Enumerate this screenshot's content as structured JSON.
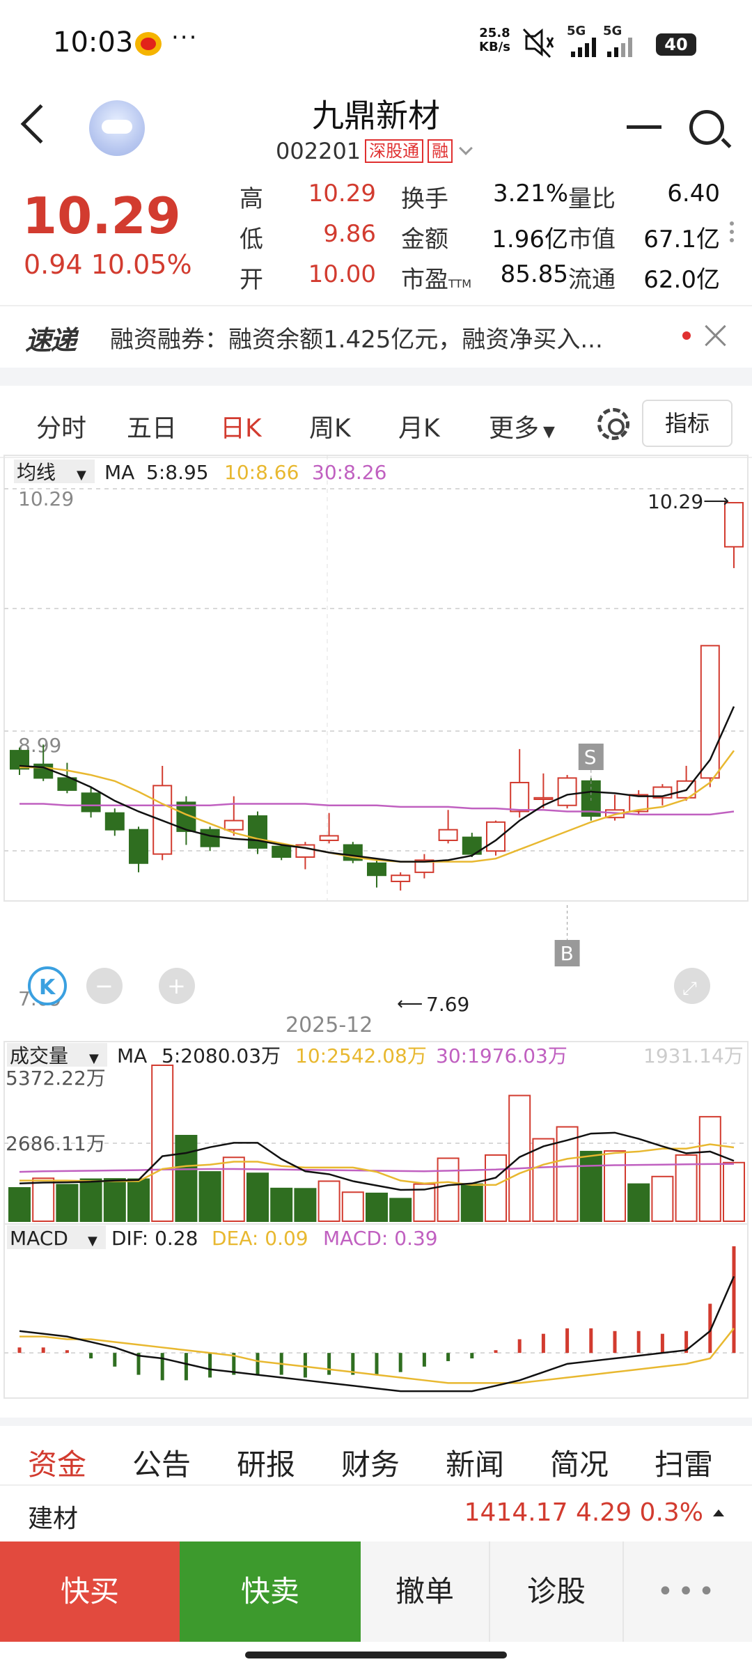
{
  "status_bar": {
    "time": "10:03",
    "dots": "···",
    "net_rate_value": "25.8",
    "net_rate_unit": "KB/s",
    "battery": "40",
    "signal1": "5G",
    "signal2": "5G"
  },
  "header": {
    "title": "九鼎新材",
    "code": "002201",
    "tag1": "深股通",
    "tag2": "融"
  },
  "quote": {
    "price": "10.29",
    "change": "0.94  10.05%",
    "rows": [
      [
        {
          "label": "高",
          "value": "10.29"
        },
        {
          "label": "换手",
          "value": "3.21%"
        },
        {
          "label": "量比",
          "value": "6.40"
        }
      ],
      [
        {
          "label": "低",
          "value": "9.86"
        },
        {
          "label": "金额",
          "value": "1.96亿"
        },
        {
          "label": "市值",
          "value": "67.1亿"
        }
      ],
      [
        {
          "label": "开",
          "value": "10.00"
        },
        {
          "label": "市盈",
          "label_sub": "TTM",
          "value": "85.85"
        },
        {
          "label": "流通",
          "value": "62.0亿"
        }
      ]
    ]
  },
  "ticker": {
    "logo": "速递",
    "text": "融资融券：融资余额1.425亿元，融资净买入..."
  },
  "chart_tabs": {
    "items": [
      "分时",
      "五日",
      "日K",
      "周K",
      "月K",
      "更多"
    ],
    "active": "日K",
    "indicator_button": "指标"
  },
  "colors": {
    "up": "#d23b2f",
    "down": "#2f6e20",
    "ma5": "#111111",
    "ma10": "#e8b830",
    "ma30": "#c060c0",
    "buy": "#e24a3e",
    "sell": "#3d9a2d"
  },
  "chart_data": [
    {
      "type": "candlestick",
      "legend": {
        "label": "均线",
        "ma_label": "MA",
        "ma5": "5:8.95",
        "ma10": "10:8.66",
        "ma30": "30:8.26"
      },
      "y_labels": [
        "10.29",
        "8.99",
        "7.69"
      ],
      "ylim": [
        7.69,
        10.29
      ],
      "x_label": "2025-12",
      "high_marker": "10.29",
      "low_marker": "7.69",
      "signals": [
        {
          "label": "S",
          "index": 24
        },
        {
          "label": "B",
          "index": 23
        }
      ],
      "candles": [
        {
          "o": 8.66,
          "c": 8.54,
          "h": 8.68,
          "l": 8.5
        },
        {
          "o": 8.57,
          "c": 8.48,
          "h": 8.7,
          "l": 8.46
        },
        {
          "o": 8.48,
          "c": 8.4,
          "h": 8.58,
          "l": 8.38
        },
        {
          "o": 8.38,
          "c": 8.26,
          "h": 8.42,
          "l": 8.22
        },
        {
          "o": 8.25,
          "c": 8.14,
          "h": 8.28,
          "l": 8.1
        },
        {
          "o": 8.14,
          "c": 7.92,
          "h": 8.16,
          "l": 7.86
        },
        {
          "o": 7.98,
          "c": 8.43,
          "h": 8.56,
          "l": 7.94
        },
        {
          "o": 8.32,
          "c": 8.13,
          "h": 8.36,
          "l": 8.04
        },
        {
          "o": 8.14,
          "c": 8.03,
          "h": 8.16,
          "l": 8.0
        },
        {
          "o": 8.14,
          "c": 8.2,
          "h": 8.36,
          "l": 8.1
        },
        {
          "o": 8.23,
          "c": 8.02,
          "h": 8.26,
          "l": 7.98
        },
        {
          "o": 8.03,
          "c": 7.96,
          "h": 8.04,
          "l": 7.94
        },
        {
          "o": 7.96,
          "c": 8.04,
          "h": 8.06,
          "l": 7.88
        },
        {
          "o": 8.07,
          "c": 8.1,
          "h": 8.25,
          "l": 8.05
        },
        {
          "o": 8.04,
          "c": 7.94,
          "h": 8.06,
          "l": 7.92
        },
        {
          "o": 7.92,
          "c": 7.84,
          "h": 7.94,
          "l": 7.76
        },
        {
          "o": 7.8,
          "c": 7.84,
          "h": 7.86,
          "l": 7.74
        },
        {
          "o": 7.86,
          "c": 7.94,
          "h": 7.98,
          "l": 7.82
        },
        {
          "o": 8.07,
          "c": 8.14,
          "h": 8.27,
          "l": 8.05
        },
        {
          "o": 8.09,
          "c": 7.98,
          "h": 8.12,
          "l": 7.96
        },
        {
          "o": 8.0,
          "c": 8.19,
          "h": 8.2,
          "l": 7.97
        },
        {
          "o": 8.26,
          "c": 8.45,
          "h": 8.67,
          "l": 8.22
        },
        {
          "o": 8.34,
          "c": 8.35,
          "h": 8.51,
          "l": 8.28
        },
        {
          "o": 8.3,
          "c": 8.48,
          "h": 8.5,
          "l": 8.28
        },
        {
          "o": 8.46,
          "c": 8.23,
          "h": 8.48,
          "l": 8.2
        },
        {
          "o": 8.22,
          "c": 8.27,
          "h": 8.37,
          "l": 8.2
        },
        {
          "o": 8.26,
          "c": 8.37,
          "h": 8.4,
          "l": 8.24
        },
        {
          "o": 8.35,
          "c": 8.42,
          "h": 8.44,
          "l": 8.3
        },
        {
          "o": 8.35,
          "c": 8.46,
          "h": 8.56,
          "l": 8.33
        },
        {
          "o": 8.48,
          "c": 9.35,
          "h": 9.35,
          "l": 8.42
        },
        {
          "o": 10.0,
          "c": 10.29,
          "h": 10.29,
          "l": 9.86
        }
      ],
      "ma5": [
        8.56,
        8.55,
        8.49,
        8.42,
        8.33,
        8.26,
        8.2,
        8.14,
        8.1,
        8.08,
        8.07,
        8.04,
        8.02,
        7.99,
        7.97,
        7.95,
        7.93,
        7.93,
        7.94,
        7.97,
        8.07,
        8.2,
        8.3,
        8.37,
        8.39,
        8.38,
        8.36,
        8.36,
        8.4,
        8.6,
        8.95
      ],
      "ma10": [
        8.55,
        8.55,
        8.53,
        8.5,
        8.46,
        8.39,
        8.31,
        8.24,
        8.18,
        8.12,
        8.08,
        8.05,
        8.02,
        7.99,
        7.96,
        7.94,
        7.93,
        7.93,
        7.93,
        7.93,
        7.95,
        8.01,
        8.07,
        8.13,
        8.19,
        8.24,
        8.27,
        8.29,
        8.34,
        8.45,
        8.66
      ],
      "ma30": [
        8.31,
        8.31,
        8.3,
        8.3,
        8.3,
        8.3,
        8.3,
        8.3,
        8.3,
        8.31,
        8.31,
        8.31,
        8.31,
        8.3,
        8.3,
        8.3,
        8.29,
        8.29,
        8.29,
        8.28,
        8.28,
        8.27,
        8.27,
        8.26,
        8.26,
        8.25,
        8.24,
        8.24,
        8.24,
        8.24,
        8.26
      ]
    },
    {
      "type": "bar",
      "legend": {
        "label": "成交量",
        "ma_label": "MA",
        "ma5": "5:2080.03万",
        "ma10": "10:2542.08万",
        "ma30": "30:1976.03万"
      },
      "right_label": "1931.14万",
      "y_labels": [
        "5372.22万",
        "2686.11万"
      ],
      "ylim": [
        0,
        5372.22
      ],
      "values": [
        1150,
        1480,
        1260,
        1450,
        1460,
        1450,
        5372,
        2950,
        1700,
        2200,
        1650,
        1130,
        1120,
        1380,
        1000,
        960,
        780,
        1280,
        2170,
        1280,
        2280,
        4330,
        2840,
        3250,
        2400,
        2420,
        1280,
        1540,
        2280,
        3600,
        2020
      ],
      "up": [
        false,
        true,
        false,
        false,
        false,
        false,
        true,
        false,
        false,
        true,
        false,
        false,
        false,
        true,
        true,
        false,
        false,
        true,
        true,
        false,
        true,
        true,
        true,
        true,
        false,
        true,
        false,
        true,
        true,
        true,
        true
      ],
      "ma5": [
        1300,
        1330,
        1340,
        1360,
        1400,
        1420,
        2240,
        2350,
        2550,
        2700,
        2700,
        2140,
        1720,
        1620,
        1380,
        1230,
        1080,
        1090,
        1240,
        1300,
        1500,
        2210,
        2580,
        2790,
        3020,
        3050,
        2840,
        2580,
        2340,
        2400,
        2080
      ],
      "ma10": [
        1400,
        1400,
        1400,
        1380,
        1380,
        1380,
        1800,
        1900,
        1950,
        2050,
        2050,
        1900,
        1850,
        1850,
        1850,
        1700,
        1400,
        1300,
        1350,
        1250,
        1250,
        1650,
        1950,
        2150,
        2250,
        2350,
        2400,
        2500,
        2500,
        2650,
        2542
      ],
      "ma30": [
        1700,
        1720,
        1730,
        1740,
        1750,
        1760,
        1780,
        1790,
        1800,
        1800,
        1790,
        1780,
        1770,
        1760,
        1750,
        1740,
        1730,
        1720,
        1740,
        1760,
        1780,
        1820,
        1860,
        1890,
        1910,
        1930,
        1940,
        1950,
        1960,
        1970,
        1976
      ]
    },
    {
      "type": "bar",
      "legend": {
        "label": "MACD",
        "dif": "DIF: 0.28",
        "dea": "DEA: 0.09",
        "macd": "MACD: 0.39"
      },
      "ylim": [
        -0.16,
        0.39
      ],
      "dif": [
        0.08,
        0.07,
        0.06,
        0.04,
        0.02,
        -0.01,
        -0.02,
        -0.04,
        -0.06,
        -0.07,
        -0.08,
        -0.09,
        -0.1,
        -0.11,
        -0.12,
        -0.13,
        -0.14,
        -0.14,
        -0.14,
        -0.14,
        -0.12,
        -0.1,
        -0.07,
        -0.04,
        -0.03,
        -0.02,
        -0.01,
        0.0,
        0.01,
        0.08,
        0.28
      ],
      "dea": [
        0.06,
        0.06,
        0.05,
        0.05,
        0.04,
        0.03,
        0.02,
        0.01,
        0.0,
        -0.01,
        -0.03,
        -0.04,
        -0.05,
        -0.06,
        -0.07,
        -0.08,
        -0.09,
        -0.1,
        -0.11,
        -0.11,
        -0.11,
        -0.11,
        -0.1,
        -0.09,
        -0.08,
        -0.07,
        -0.06,
        -0.05,
        -0.04,
        -0.02,
        0.09
      ],
      "macd": [
        0.02,
        0.02,
        0.01,
        -0.02,
        -0.05,
        -0.08,
        -0.1,
        -0.1,
        -0.09,
        -0.08,
        -0.08,
        -0.08,
        -0.09,
        -0.08,
        -0.08,
        -0.08,
        -0.07,
        -0.05,
        -0.03,
        -0.02,
        0.01,
        0.05,
        0.07,
        0.09,
        0.09,
        0.08,
        0.08,
        0.07,
        0.08,
        0.18,
        0.39
      ]
    }
  ],
  "bottom_tabs": {
    "items": [
      "资金",
      "公告",
      "研报",
      "财务",
      "新闻",
      "简况",
      "扫雷"
    ],
    "active": "资金"
  },
  "sector": {
    "name": "建材",
    "values": "1414.17  4.29  0.3%"
  },
  "actions": {
    "buy": "快买",
    "sell": "快卖",
    "cancel": "撤单",
    "diagnose": "诊股",
    "more": "•••"
  }
}
